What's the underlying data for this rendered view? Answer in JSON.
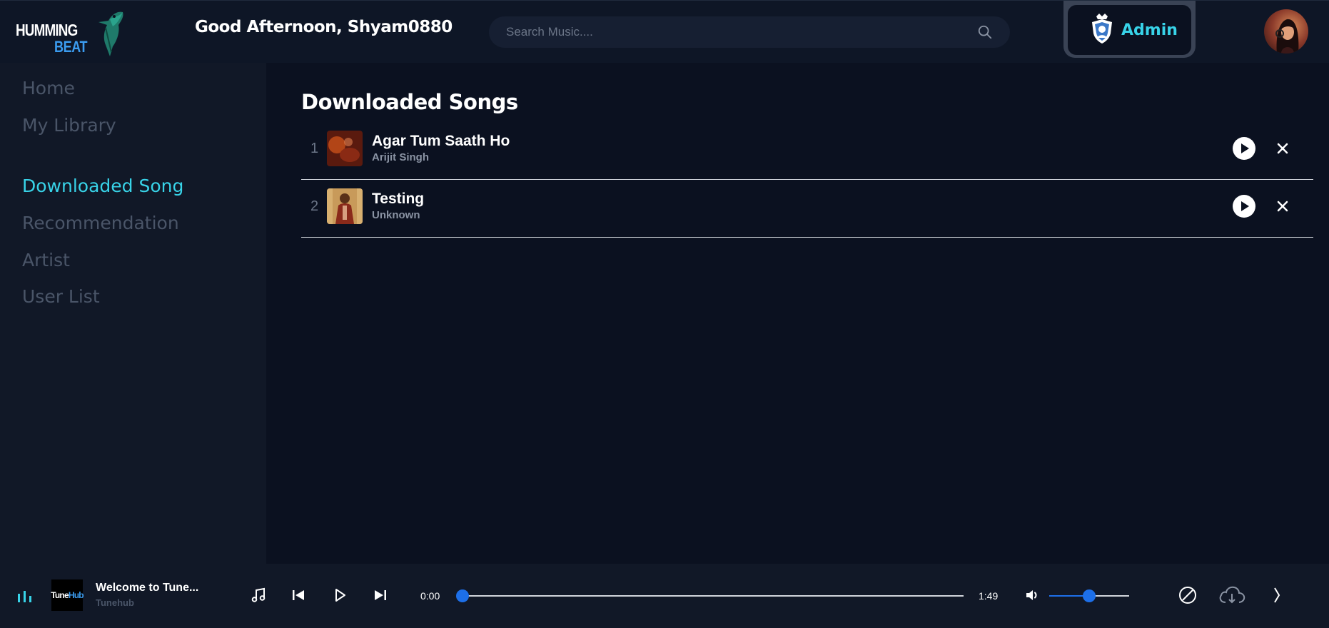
{
  "header": {
    "logo_line1": "HUMMING",
    "logo_line2": "BEAT",
    "greeting": "Good Afternoon, Shyam0880",
    "search_placeholder": "Search Music....",
    "admin_label": "Admin"
  },
  "sidebar": {
    "items": [
      {
        "label": "Home",
        "active": false
      },
      {
        "label": "My Library",
        "active": false
      },
      {
        "label": "Downloaded Song",
        "active": true
      },
      {
        "label": "Recommendation",
        "active": false
      },
      {
        "label": "Artist",
        "active": false
      },
      {
        "label": "User List",
        "active": false
      }
    ]
  },
  "main": {
    "title": "Downloaded Songs",
    "songs": [
      {
        "number": "1",
        "title": "Agar Tum Saath Ho",
        "artist": "Arijit Singh"
      },
      {
        "number": "2",
        "title": "Testing",
        "artist": "Unknown"
      }
    ]
  },
  "player": {
    "art_text_1": "Tune",
    "art_text_2": "Hub",
    "track_title": "Welcome to Tune...",
    "track_artist": "Tunehub",
    "current_time": "0:00",
    "duration": "1:49",
    "progress": 0,
    "volume": 0.5
  },
  "colors": {
    "accent": "#38d3e8",
    "blue": "#1d6fe8",
    "background": "#0b1120",
    "sidebar": "#111827"
  },
  "icons": [
    "bird-logo-icon",
    "search-icon",
    "admin-shield-icon",
    "play-icon",
    "close-icon",
    "equalizer-icon",
    "music-note-icon",
    "previous-icon",
    "next-icon",
    "volume-icon",
    "no-loop-icon",
    "download-cloud-icon",
    "chevron-right-icon"
  ]
}
